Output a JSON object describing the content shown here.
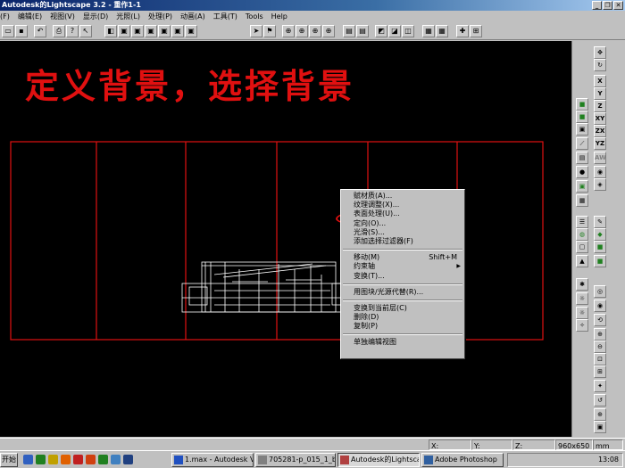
{
  "window": {
    "title": "Autodesk的Lightscape 3.2 - 重作1-1",
    "controls": [
      "_",
      "❐",
      "✕"
    ]
  },
  "menu": [
    "(F)",
    "编辑(E)",
    "视图(V)",
    "显示(D)",
    "光照(L)",
    "处理(P)",
    "动画(A)",
    "工具(T)",
    "Tools",
    "Help"
  ],
  "headline": "定义背景，选择背景",
  "context_menu": {
    "items": [
      {
        "label": "赋材质(A)...",
        "shortcut": ""
      },
      {
        "label": "纹理调整(X)...",
        "shortcut": ""
      },
      {
        "label": "表面处理(U)...",
        "shortcut": ""
      },
      {
        "label": "定向(O)...",
        "shortcut": ""
      },
      {
        "label": "光滑(S)...",
        "shortcut": ""
      },
      {
        "label": "添加选择过滤器(F)",
        "shortcut": ""
      },
      {
        "label": "移动(M)",
        "shortcut": "Shift+M"
      },
      {
        "label": "约束轴",
        "shortcut": "",
        "submenu": true
      },
      {
        "label": "变换(T)...",
        "shortcut": ""
      },
      {
        "label": "用图块/光源代替(R)...",
        "shortcut": ""
      },
      {
        "label": "变换到当前层(C)",
        "shortcut": ""
      },
      {
        "label": "删除(D)",
        "shortcut": ""
      },
      {
        "label": "复制(P)",
        "shortcut": ""
      },
      {
        "label": "单独编辑视图",
        "shortcut": ""
      }
    ],
    "highlight_index": 2
  },
  "right_panel": {
    "axis_labels": [
      "X",
      "Y",
      "Z",
      "XY",
      "ZX",
      "YZ",
      "AW"
    ]
  },
  "status": {
    "x_label": "X:",
    "y_label": "Y:",
    "z_label": "Z:",
    "resolution": "960x650",
    "units": "mm"
  },
  "taskbar": {
    "start": "开始",
    "tasks": [
      "1.max - Autodesk V...",
      "705281-p_015_1_bi...",
      "Autodesk的Lightsca...",
      "Adobe Photoshop"
    ],
    "active_index": 2,
    "time": "13:08"
  },
  "colors": {
    "annotation_red": "#e01010",
    "viewport_bg": "#000000",
    "wire": "#ffffff"
  }
}
